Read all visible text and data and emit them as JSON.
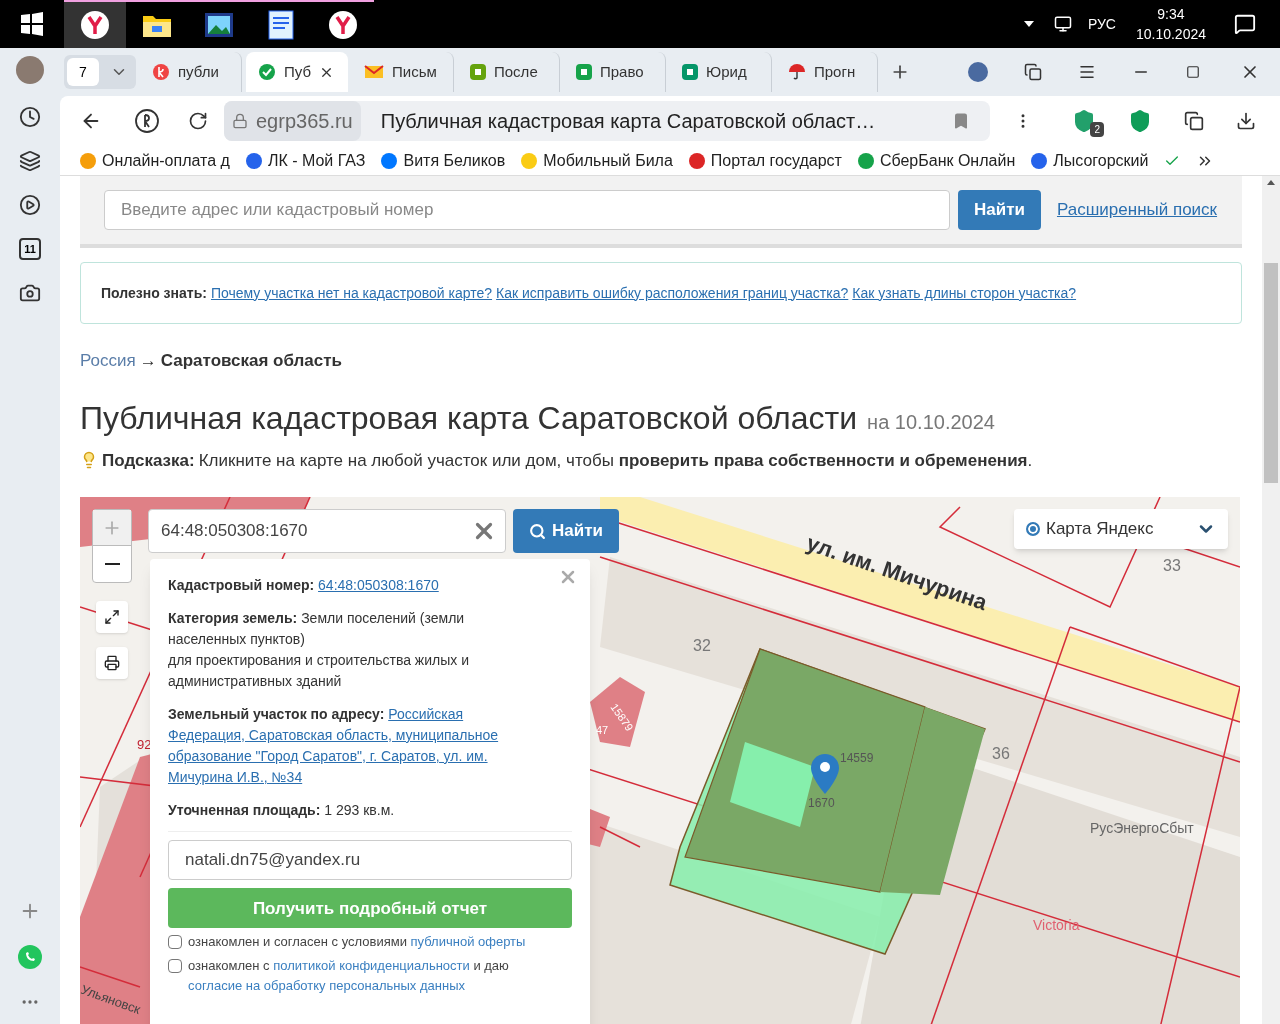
{
  "taskbar": {
    "apps": [
      {
        "kind": "browser",
        "active": true
      },
      {
        "kind": "folder",
        "active": false
      },
      {
        "kind": "picture",
        "active": false
      },
      {
        "kind": "document",
        "active": false
      },
      {
        "kind": "browser",
        "active": false
      }
    ],
    "language": "РУС",
    "time": "9:34",
    "date": "10.10.2024"
  },
  "browser": {
    "tab_count": "7",
    "tabs": [
      {
        "label": "публи",
        "selected": false
      },
      {
        "label": "Пуб",
        "selected": true
      },
      {
        "label": "Письм",
        "selected": false
      },
      {
        "label": "После",
        "selected": false
      },
      {
        "label": "Право",
        "selected": false
      },
      {
        "label": "Юрид",
        "selected": false
      },
      {
        "label": "Прогн",
        "selected": false
      }
    ],
    "domain": "egrp365.ru",
    "page_title": "Публичная кадастровая карта Саратовской област…",
    "extension_badge": "2",
    "bookmarks": [
      {
        "label": "Онлайн-оплата д",
        "color": "#f59e0b"
      },
      {
        "label": "ЛК - Мой ГАЗ",
        "color": "#2563eb"
      },
      {
        "label": "Витя Беликов",
        "color": "#0077ff"
      },
      {
        "label": "Мобильный Била",
        "color": "#facc15"
      },
      {
        "label": "Портал государст",
        "color": "#dc2626"
      },
      {
        "label": "СберБанк Онлайн",
        "color": "#16a34a"
      },
      {
        "label": "Лысогорский",
        "color": "#2563eb"
      }
    ],
    "sidebar_calendar": "11"
  },
  "search": {
    "placeholder": "Введите адрес или кадастровый номер",
    "button": "Найти",
    "advanced_link": "Расширенный поиск"
  },
  "info": {
    "label": "Полезно знать:",
    "links": [
      "Почему участка нет на кадастровой карте?",
      "Как исправить ошибку расположения границ участка?",
      "Как узнать длины сторон участка?"
    ]
  },
  "breadcrumb": {
    "root": "Россия",
    "separator": "→",
    "current": "Саратовская область"
  },
  "heading": {
    "title": "Публичная кадастровая карта Саратовской области",
    "date": "на 10.10.2024"
  },
  "hint": {
    "label": "Подсказка:",
    "text": "Кликните на карте на любой участок или дом, чтобы **проверить права собственности и обременения**."
  },
  "map": {
    "search_value": "64:48:050308:1670",
    "search_button": "Найти",
    "layer": {
      "label": "Карта Яндекс",
      "selected": true
    },
    "labels": [
      {
        "text": "ул. им. Мичурина"
      },
      {
        "text": "33"
      },
      {
        "text": "32"
      },
      {
        "text": "36"
      },
      {
        "text": "1670"
      },
      {
        "text": "14559"
      },
      {
        "text": "РусЭнергоСбыт"
      },
      {
        "text": "Victoria"
      },
      {
        "text": "Ульяновск"
      },
      {
        "text": "47"
      },
      {
        "text": "15879"
      },
      {
        "text": "92"
      }
    ],
    "popup": {
      "cadastral_label": "Кадастровый номер:",
      "cadastral_value": "64:48:050308:1670",
      "category_label": "Категория земель:",
      "category_text": "Земли поселений (земли населенных пунктов)",
      "usage_text": "для проектирования и строительства жилых и административных зданий",
      "address_label": "Земельный участок по адресу:",
      "address_value": "Российская Федерация, Саратовская область, муниципальное образование \"Город Саратов\", г. Саратов, ул. им. Мичурина И.В., №34",
      "area_label": "Уточненная площадь:",
      "area_value": "1 293 кв.м.",
      "email": "natali.dn75@yandex.ru",
      "report_button": "Получить подробный отчет",
      "consents": [
        {
          "checked": false,
          "parts": [
            {
              "text": "ознакомлен и согласен с условиями ",
              "kind": "text"
            },
            {
              "text": "публичной оферты",
              "kind": "link"
            }
          ]
        },
        {
          "checked": false,
          "parts": [
            {
              "text": "ознакомлен с ",
              "kind": "text"
            },
            {
              "text": "политикой конфиденциальности",
              "kind": "link"
            },
            {
              "text": " и даю ",
              "kind": "text"
            },
            {
              "text": "согласие на обработку персональных данных",
              "kind": "link"
            }
          ]
        }
      ]
    }
  }
}
